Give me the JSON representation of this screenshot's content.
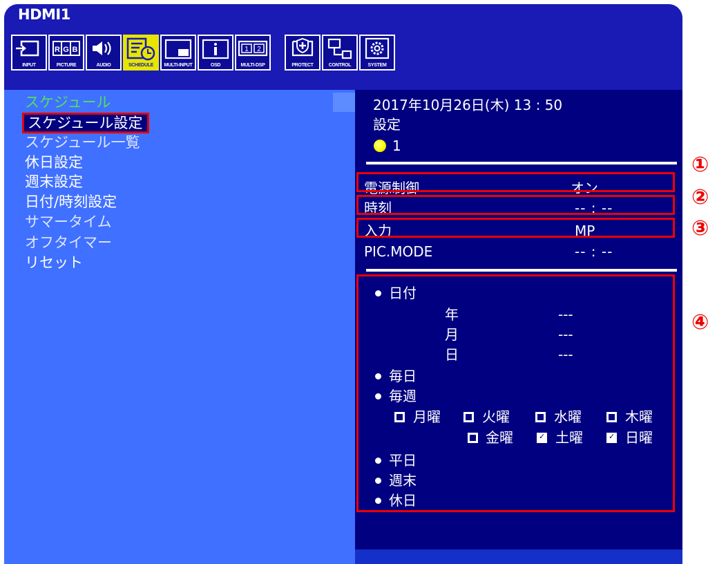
{
  "input_source": "HDMI1",
  "tabs": [
    {
      "id": "input",
      "label": "INPUT",
      "icon": "input-icon",
      "active": false
    },
    {
      "id": "picture",
      "label": "PICTURE",
      "icon": "rgb-picture-icon",
      "active": false
    },
    {
      "id": "audio",
      "label": "AUDIO",
      "icon": "speaker-icon",
      "active": false
    },
    {
      "id": "schedule",
      "label": "SCHEDULE",
      "icon": "schedule-clock-icon",
      "active": true
    },
    {
      "id": "multi-input",
      "label": "MULTI-INPUT",
      "icon": "multi-input-icon",
      "active": false
    },
    {
      "id": "osd",
      "label": "OSD",
      "icon": "info-icon",
      "active": false
    },
    {
      "id": "multi-dsp",
      "label": "MULTI-DSP",
      "icon": "multi-display-icon",
      "active": false
    },
    {
      "id": "protect",
      "label": "PROTECT",
      "icon": "shield-icon",
      "active": false
    },
    {
      "id": "control",
      "label": "CONTROL",
      "icon": "network-icon",
      "active": false
    },
    {
      "id": "system",
      "label": "SYSTEM",
      "icon": "gear-icon",
      "active": false
    }
  ],
  "menu": {
    "header": "スケジュール",
    "items": [
      "スケジュール設定",
      "スケジュール一覧",
      "休日設定",
      "週末設定",
      "日付/時刻設定",
      "サマータイム",
      "オフタイマー",
      "リセット"
    ],
    "selected_index": 0
  },
  "panel": {
    "datetime": "2017年10月26日(木) 13 : 50",
    "setting_label": "設定",
    "setting_number": "1",
    "rows": [
      {
        "label": "電源制御",
        "value": "オン"
      },
      {
        "label": "時刻",
        "value": "-- : --"
      },
      {
        "label": "入力",
        "value": "MP"
      },
      {
        "label": "PIC.MODE",
        "value": "-- : --"
      }
    ],
    "date_option": "日付",
    "date_fields": [
      {
        "label": "年",
        "value": "---"
      },
      {
        "label": "月",
        "value": "---"
      },
      {
        "label": "日",
        "value": "---"
      }
    ],
    "daily": "毎日",
    "weekly": "毎週",
    "weekdays": [
      {
        "label": "月曜",
        "checked": false
      },
      {
        "label": "火曜",
        "checked": false
      },
      {
        "label": "水曜",
        "checked": false
      },
      {
        "label": "木曜",
        "checked": false
      },
      {
        "label": "金曜",
        "checked": false
      },
      {
        "label": "土曜",
        "checked": true
      },
      {
        "label": "日曜",
        "checked": true
      }
    ],
    "weekday_option": "平日",
    "weekend_option": "週末",
    "holiday_option": "休日"
  },
  "markers": [
    "①",
    "②",
    "③",
    "④"
  ],
  "colors": {
    "osd_background": "#4070ff",
    "title_bar": "#1a1ab5",
    "panel_background": "#000080",
    "active_tab": "#e6e600",
    "menu_header": "#50e060",
    "highlight_box": "#ee0000"
  }
}
